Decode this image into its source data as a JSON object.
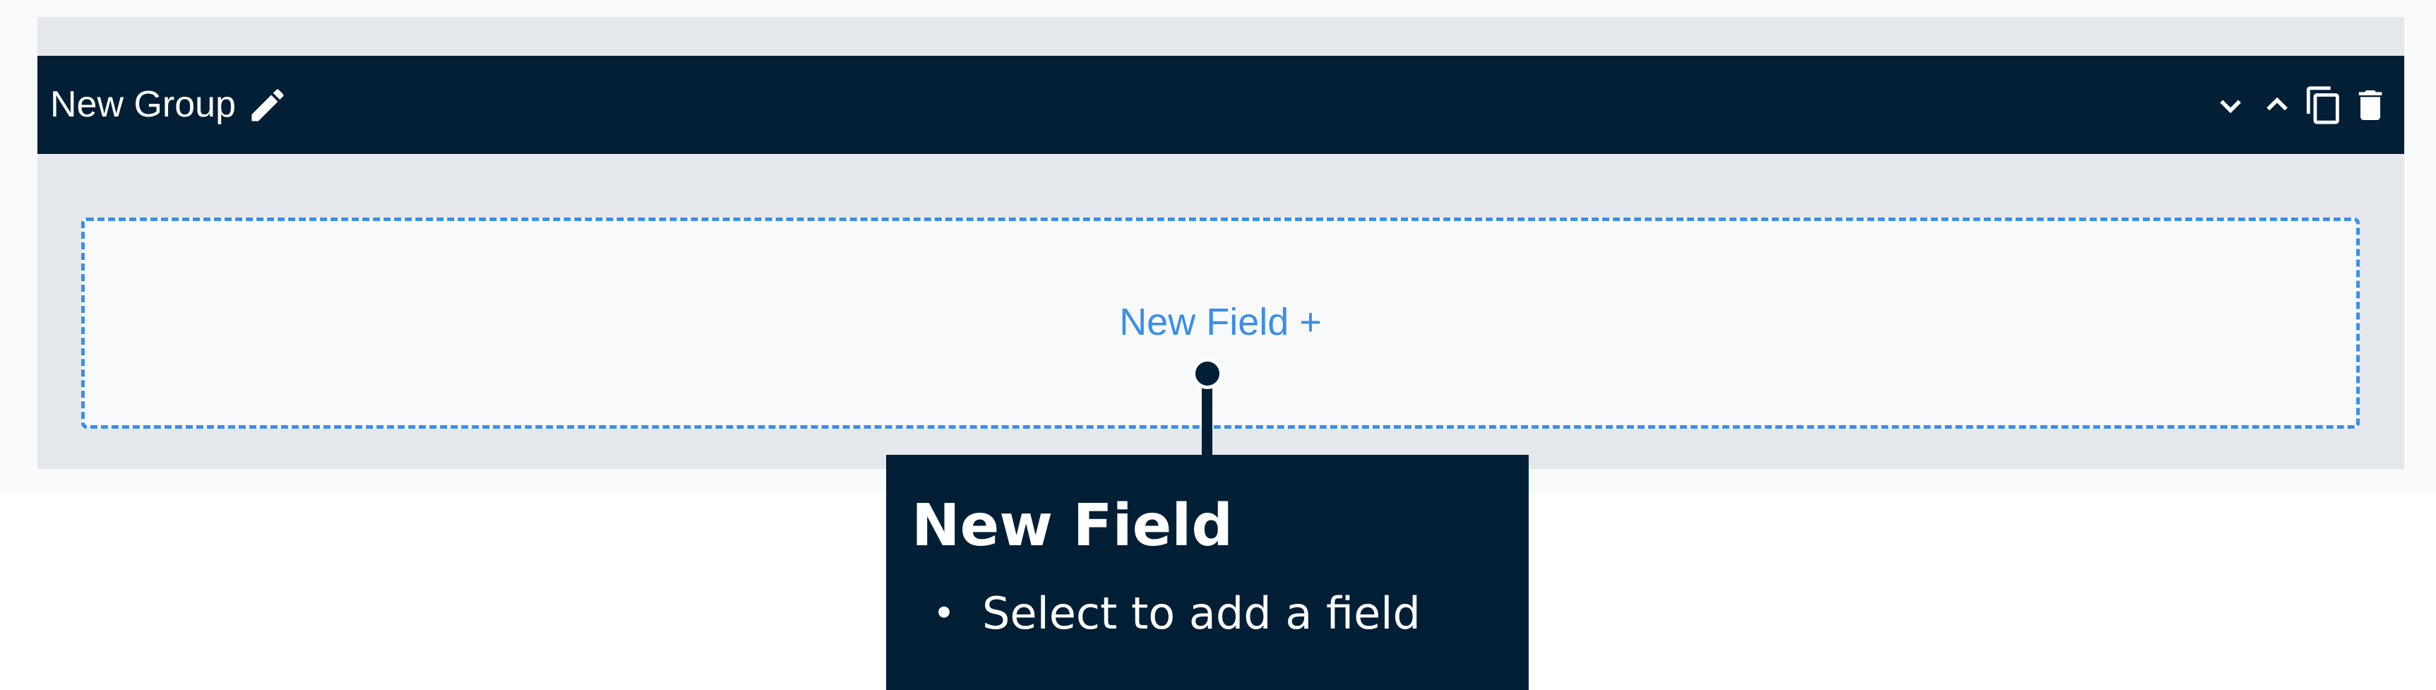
{
  "group": {
    "title": "New Group",
    "icons": {
      "edit": "pencil-icon",
      "collapse": "chevron-down-icon",
      "expand": "chevron-up-icon",
      "duplicate": "copy-icon",
      "delete": "trash-icon"
    }
  },
  "dropzone": {
    "label": "New Field +"
  },
  "tooltip": {
    "title": "New Field",
    "items": [
      "Select to add a field"
    ]
  },
  "colors": {
    "header_bg": "#021f35",
    "accent": "#3b8ee8",
    "card_bg": "#e4e7eb",
    "page_bg": "#f8f9fb"
  }
}
